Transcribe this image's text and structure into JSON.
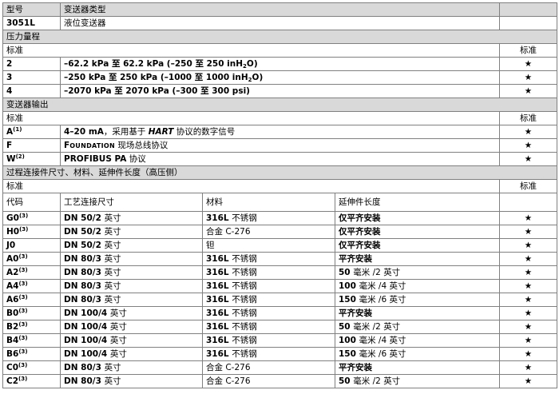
{
  "header": {
    "col1": "型号",
    "col2": "变送器类型"
  },
  "model_row": {
    "code": "3051L",
    "desc": "液位变送器"
  },
  "range": {
    "title": "压力量程",
    "label": "标准",
    "std": "标准",
    "rows": [
      {
        "code": "2",
        "a": "–62.2 kPa ",
        "z": "至",
        "b": " 62.2 kPa (–250 ",
        "z2": "至",
        "c": " 250 inH",
        "subx": "2",
        "d": "O)",
        "star": "★"
      },
      {
        "code": "3",
        "a": "–250 kPa ",
        "z": "至",
        "b": " 250 kPa (–1000 ",
        "z2": "至",
        "c": " 1000 inH",
        "subx": "2",
        "d": "O)",
        "star": "★"
      },
      {
        "code": "4",
        "a": "–2070 kPa ",
        "z": "至",
        "b": " 2070 kPa (–300 ",
        "z2": "至",
        "c": " 300 psi",
        "subx": "",
        "d": ")",
        "star": "★"
      }
    ]
  },
  "output": {
    "title": "变送器输出",
    "label": "标准",
    "std": "标准",
    "rows": [
      {
        "code": "A",
        "note": "(1)",
        "p1": "4–20 mA",
        "p2": "，采用基于 ",
        "p3": "HART",
        "p4": " 协议的数字信号",
        "star": "★"
      },
      {
        "code": "F",
        "note": "",
        "p1": "F",
        "p2": "OUNDATION",
        "p3": " 现场总线协议",
        "p4": "",
        "star": "★"
      },
      {
        "code": "W",
        "note": "(2)",
        "p1": "PROFIBUS PA",
        "p2": " 协议",
        "p3": "",
        "p4": "",
        "star": "★"
      }
    ]
  },
  "process": {
    "title": "过程连接件尺寸、材料、延伸件长度（高压侧）",
    "label": "标准",
    "std": "标准",
    "columns": {
      "code": "代码",
      "size": "工艺连接尺寸",
      "material": "材料",
      "ext": "延伸件长度"
    },
    "rows": [
      {
        "code": "G0",
        "note": "(3)",
        "size_a": "DN 50/2 ",
        "size_b": "英寸",
        "mat_a": "316L ",
        "mat_b": "不锈钢",
        "ext_a": "仅平齐安装",
        "ext_b": "",
        "ext_c": "",
        "star": "★"
      },
      {
        "code": "H0",
        "note": "(3)",
        "size_a": "DN 50/2 ",
        "size_b": "英寸",
        "mat_a": "",
        "mat_b": "合金 C-276",
        "ext_a": "仅平齐安装",
        "ext_b": "",
        "ext_c": "",
        "star": "★"
      },
      {
        "code": "J0",
        "note": "",
        "size_a": "DN 50/2 ",
        "size_b": "英寸",
        "mat_a": "",
        "mat_b": "钽",
        "ext_a": "仅平齐安装",
        "ext_b": "",
        "ext_c": "",
        "star": "★"
      },
      {
        "code": "A0",
        "note": "(3)",
        "size_a": "DN 80/3 ",
        "size_b": "英寸",
        "mat_a": "316L ",
        "mat_b": "不锈钢",
        "ext_a": "平齐安装",
        "ext_b": "",
        "ext_c": "",
        "star": "★"
      },
      {
        "code": "A2",
        "note": "(3)",
        "size_a": "DN 80/3 ",
        "size_b": "英寸",
        "mat_a": "316L ",
        "mat_b": "不锈钢",
        "ext_a": "50 ",
        "ext_b": "毫米 /2 ",
        "ext_c": "英寸",
        "star": "★"
      },
      {
        "code": "A4",
        "note": "(3)",
        "size_a": "DN 80/3 ",
        "size_b": "英寸",
        "mat_a": "316L ",
        "mat_b": "不锈钢",
        "ext_a": "100 ",
        "ext_b": "毫米 /4 ",
        "ext_c": "英寸",
        "star": "★"
      },
      {
        "code": "A6",
        "note": "(3)",
        "size_a": "DN 80/3 ",
        "size_b": "英寸",
        "mat_a": "316L ",
        "mat_b": "不锈钢",
        "ext_a": "150 ",
        "ext_b": "毫米 /6 ",
        "ext_c": "英寸",
        "star": "★"
      },
      {
        "code": "B0",
        "note": "(3)",
        "size_a": "DN 100/4 ",
        "size_b": "英寸",
        "mat_a": "316L ",
        "mat_b": "不锈钢",
        "ext_a": "平齐安装",
        "ext_b": "",
        "ext_c": "",
        "star": "★"
      },
      {
        "code": "B2",
        "note": "(3)",
        "size_a": "DN 100/4 ",
        "size_b": "英寸",
        "mat_a": "316L ",
        "mat_b": "不锈钢",
        "ext_a": "50 ",
        "ext_b": "毫米 /2 ",
        "ext_c": "英寸",
        "star": "★"
      },
      {
        "code": "B4",
        "note": "(3)",
        "size_a": "DN 100/4 ",
        "size_b": "英寸",
        "mat_a": "316L ",
        "mat_b": "不锈钢",
        "ext_a": "100 ",
        "ext_b": "毫米 /4 ",
        "ext_c": "英寸",
        "star": "★"
      },
      {
        "code": "B6",
        "note": "(3)",
        "size_a": "DN 100/4 ",
        "size_b": "英寸",
        "mat_a": "316L ",
        "mat_b": "不锈钢",
        "ext_a": "150 ",
        "ext_b": "毫米 /6 ",
        "ext_c": "英寸",
        "star": "★"
      },
      {
        "code": "C0",
        "note": "(3)",
        "size_a": "DN 80/3 ",
        "size_b": "英寸",
        "mat_a": "",
        "mat_b": "合金 C-276",
        "ext_a": "平齐安装",
        "ext_b": "",
        "ext_c": "",
        "star": "★"
      },
      {
        "code": "C2",
        "note": "(3)",
        "size_a": "DN 80/3 ",
        "size_b": "英寸",
        "mat_a": "",
        "mat_b": "合金 C-276",
        "ext_a": "50 ",
        "ext_b": "毫米 /2 ",
        "ext_c": "英寸",
        "star": "★"
      }
    ]
  }
}
